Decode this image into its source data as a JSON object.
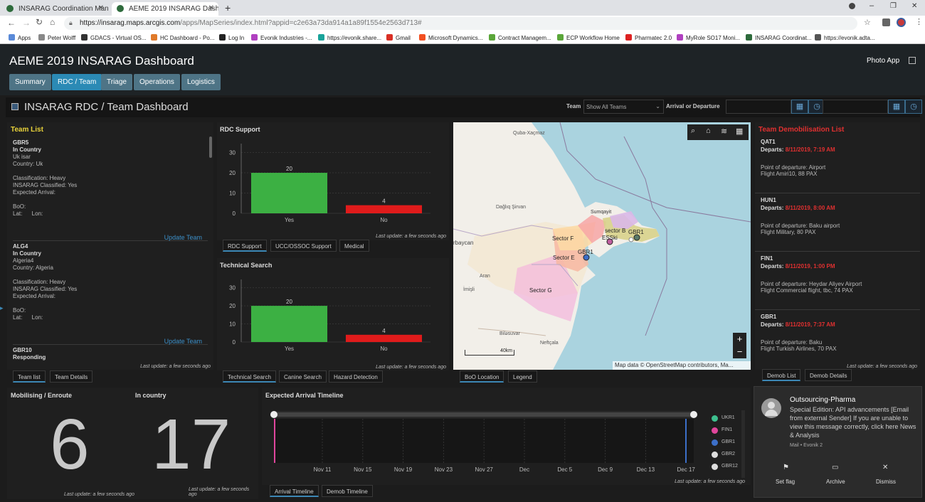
{
  "browser": {
    "tabs": [
      {
        "label": "INSARAG Coordination Manage"
      },
      {
        "label": "AEME 2019 INSARAG Dashboard"
      }
    ],
    "new_tab": "+",
    "url_host": "https://insarag.maps.arcgis.com",
    "url_path": "/apps/MapSeries/index.html?appid=c2e63a73da914a1a89f1554e2563d713#",
    "bookmarks": [
      "Apps",
      "Peter Wolff",
      "GDACS - Virtual OS...",
      "HC Dashboard - Po...",
      "Log In",
      "Evonik Industries -...",
      "https://evonik.share...",
      "Gmail",
      "Microsoft Dynamics...",
      "Contract Managem...",
      "ECP Workflow Home",
      "Pharmatec 2.0",
      "MyRole SO17 Moni...",
      "INSARAG Coordinat...",
      "https://evonik.adta..."
    ]
  },
  "header": {
    "title": "AEME 2019 INSARAG Dashboard",
    "photo_app": "Photo App",
    "nav_tabs": [
      "Summary",
      "RDC / Team",
      "Triage",
      "Operations",
      "Logistics"
    ],
    "active_tab": "RDC / Team"
  },
  "subheader": {
    "title": "INSARAG RDC / Team Dashboard",
    "team_label": "Team",
    "team_value": "Show All Teams",
    "arrival_label": "Arrival or Departure"
  },
  "team_list": {
    "title": "Team List",
    "title_color": "#e8d23a",
    "teams": [
      {
        "code": "GBR5",
        "status": "In Country",
        "name": "Uk isar",
        "country": "Country: Uk",
        "classification": "Classification: Heavy",
        "insarag": "INSARAG Classified:  Yes",
        "arrival": "Expected Arrival:",
        "boo": "BoO:",
        "latlon": "Lat:      Lon:",
        "update": "Update Team"
      },
      {
        "code": "ALG4",
        "status": "In Country",
        "name": "Algeria4",
        "country": "Country: Algeria",
        "classification": "Classification: Heavy",
        "insarag": "INSARAG Classified:  Yes",
        "arrival": "Expected Arrival:",
        "boo": "BoO:",
        "latlon": "Lat:      Lon:",
        "update": "Update Team"
      },
      {
        "code": "GBR10",
        "status": "Responding"
      }
    ],
    "last_update": "Last update: a few seconds ago",
    "tabs": [
      "Team list",
      "Team Details"
    ]
  },
  "rdc_support": {
    "title": "RDC Support",
    "last_update": "Last update: a few seconds ago",
    "tabs": [
      "RDC Support",
      "UCC/OSSOC Support",
      "Medical"
    ]
  },
  "technical_search": {
    "title": "Technical Search",
    "last_update": "Last update: a few seconds ago",
    "tabs": [
      "Technical Search",
      "Canine Search",
      "Hazard Detection"
    ]
  },
  "chart_data": [
    {
      "type": "bar",
      "title": "RDC Support",
      "categories": [
        "Yes",
        "No"
      ],
      "values": [
        20,
        4
      ],
      "colors": [
        "#3cb043",
        "#e01b1b"
      ],
      "yticks": [
        0,
        10,
        20,
        30
      ],
      "ylim": [
        0,
        33
      ]
    },
    {
      "type": "bar",
      "title": "Technical Search",
      "categories": [
        "Yes",
        "No"
      ],
      "values": [
        20,
        4
      ],
      "colors": [
        "#3cb043",
        "#e01b1b"
      ],
      "yticks": [
        0,
        10,
        20,
        30
      ],
      "ylim": [
        0,
        33
      ]
    }
  ],
  "map": {
    "labels": {
      "quba": "Quba-Xaçmaz",
      "sumqayit": "Sumqayit",
      "dagliq": "Dağlıq Şirvan",
      "arbaycan": "rbaycan",
      "imisli": "İmişli",
      "bilasuvar": "Biləsuvar",
      "neftcala": "Neftçala",
      "aran": "Aran",
      "sectorF": "Sector F",
      "sectorE": "Sector E",
      "sectorG": "Sector G",
      "sectorB": "sector B",
      "gbr1a": "GBR1",
      "gbr1b": "GBR1",
      "esski": "ESSki"
    },
    "scale": "40km",
    "attribution": "Map data © OpenStreetMap contributors, Ma...",
    "zoom_in": "+",
    "zoom_out": "−",
    "tabs": [
      "BoO Location",
      "Legend"
    ]
  },
  "demob": {
    "title": "Team Demobilisation List",
    "title_color": "#e03030",
    "departs_label": "Departs:",
    "items": [
      {
        "code": "QAT1",
        "date": "8/11/2019, 7:19 AM",
        "point": "Point of departure: Airport",
        "flight": "Flight Amiri10, 88 PAX"
      },
      {
        "code": "HUN1",
        "date": "8/11/2019, 8:00 AM",
        "point": "Point of departure: Baku airport",
        "flight": "Flight Military, 80 PAX"
      },
      {
        "code": "FIN1",
        "date": "8/11/2019, 1:00 PM",
        "point": "Point of departure: Heydar Aliyev Airport",
        "flight": "Flight Commercial flight, tbc, 74 PAX"
      },
      {
        "code": "GBR1",
        "date": "8/11/2019, 7:37 AM",
        "point": "Point of departure: Baku",
        "flight": "Flight Turkish Airlines, 70 PAX"
      }
    ],
    "last_update": "Last update: a few seconds ago",
    "tabs": [
      "Demob List",
      "Demob Details"
    ]
  },
  "stats": {
    "mobilising_label": "Mobilising / Enroute",
    "mobilising_value": "6",
    "incountry_label": "In country",
    "incountry_value": "17",
    "last_update_left": "Last update: a few seconds ago",
    "last_update_right": "Last update: a few seconds ago"
  },
  "timeline": {
    "title": "Expected Arrival Timeline",
    "x_labels": [
      "Nov 11",
      "Nov 15",
      "Nov 19",
      "Nov 23",
      "Nov 27",
      "Dec",
      "Dec 5",
      "Dec 9",
      "Dec 13",
      "Dec 17"
    ],
    "series": [
      {
        "name": "UKR1",
        "color": "#3dbf8e"
      },
      {
        "name": "FIN1",
        "color": "#e0469c"
      },
      {
        "name": "GBR1",
        "color": "#3c6fc8"
      },
      {
        "name": "GBR2",
        "color": "#dddddd"
      },
      {
        "name": "GBR12",
        "color": "#dddddd"
      }
    ],
    "last_update": "Last update: a few seconds ago",
    "tabs": [
      "Arrival Timeline",
      "Demob Timeline"
    ]
  },
  "notification": {
    "title": "Outsourcing-Pharma",
    "body": "Special Edition: API advancements [Email from external Sender] If you are unable to view this message correctly, click here News & Analysis",
    "source": "Mail • Evonik 2",
    "actions": [
      "Set flag",
      "Archive",
      "Dismiss"
    ]
  }
}
